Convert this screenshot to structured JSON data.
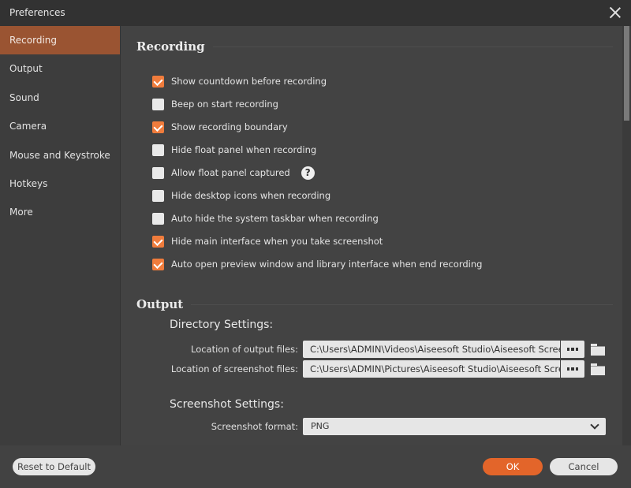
{
  "window": {
    "title": "Preferences"
  },
  "sidebar": {
    "items": [
      {
        "label": "Recording",
        "active": true
      },
      {
        "label": "Output"
      },
      {
        "label": "Sound"
      },
      {
        "label": "Camera"
      },
      {
        "label": "Mouse and Keystroke"
      },
      {
        "label": "Hotkeys"
      },
      {
        "label": "More"
      }
    ]
  },
  "recording": {
    "title": "Recording",
    "options": [
      {
        "label": "Show countdown before recording",
        "checked": true
      },
      {
        "label": "Beep on start recording",
        "checked": false
      },
      {
        "label": "Show recording boundary",
        "checked": true
      },
      {
        "label": "Hide float panel when recording",
        "checked": false
      },
      {
        "label": "Allow float panel captured",
        "checked": false,
        "help": "?"
      },
      {
        "label": "Hide desktop icons when recording",
        "checked": false
      },
      {
        "label": "Auto hide the system taskbar when recording",
        "checked": false
      },
      {
        "label": "Hide main interface when you take screenshot",
        "checked": true
      },
      {
        "label": "Auto open preview window and library interface when end recording",
        "checked": true
      }
    ]
  },
  "output": {
    "title": "Output",
    "directory_title": "Directory Settings:",
    "output_files_label": "Location of output files:",
    "output_files_value": "C:\\Users\\ADMIN\\Videos\\Aiseesoft Studio\\Aiseesoft Screen Recorder",
    "screenshot_files_label": "Location of screenshot files:",
    "screenshot_files_value": "C:\\Users\\ADMIN\\Pictures\\Aiseesoft Studio\\Aiseesoft Screen Recorder",
    "screenshot_settings_title": "Screenshot Settings:",
    "screenshot_format_label": "Screenshot format:",
    "screenshot_format_value": "PNG"
  },
  "footer": {
    "reset_label": "Reset to Default",
    "ok_label": "OK",
    "cancel_label": "Cancel"
  },
  "colors": {
    "accent": "#e3652a",
    "checkbox": "#f07c3c",
    "sidebar_active": "#9a5432"
  }
}
